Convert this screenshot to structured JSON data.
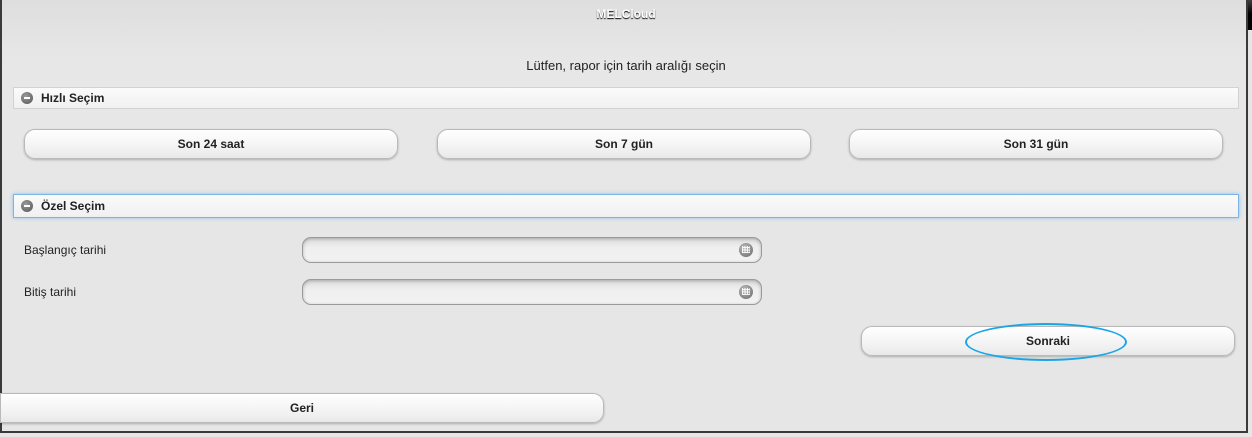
{
  "app": {
    "title": "MELCloud"
  },
  "prompt": "Lütfen, rapor için tarih aralığı seçin",
  "quick_select": {
    "header": "Hızlı Seçim",
    "buttons": [
      "Son 24 saat",
      "Son 7 gün",
      "Son 31 gün"
    ]
  },
  "custom_select": {
    "header": "Özel Seçim",
    "start_label": "Başlangıç tarihi",
    "start_value": "",
    "end_label": "Bitiş tarihi",
    "end_value": ""
  },
  "actions": {
    "next_label": "Sonraki",
    "back_label": "Geri"
  },
  "colors": {
    "highlight": "#1aa6e6",
    "titlebar_red": "#e01010",
    "titlebar_black": "#000000"
  }
}
